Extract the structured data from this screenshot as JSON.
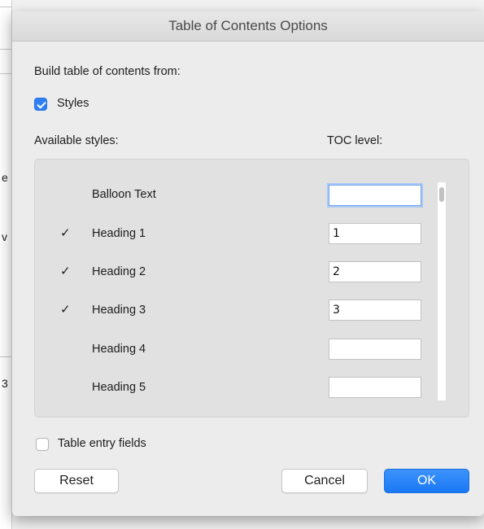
{
  "window": {
    "title": "Table of Contents Options"
  },
  "background": {
    "chars": [
      "e",
      "v",
      "3"
    ]
  },
  "build": {
    "heading": "Build table of contents from:",
    "styles_checkbox": {
      "label": "Styles",
      "checked": true
    }
  },
  "columns": {
    "available_styles": "Available styles:",
    "toc_level": "TOC level:"
  },
  "styles": [
    {
      "name": "Balloon Text",
      "checked": false,
      "level": ""
    },
    {
      "name": "Heading 1",
      "checked": true,
      "level": "1"
    },
    {
      "name": "Heading 2",
      "checked": true,
      "level": "2"
    },
    {
      "name": "Heading 3",
      "checked": true,
      "level": "3"
    },
    {
      "name": "Heading 4",
      "checked": false,
      "level": ""
    },
    {
      "name": "Heading 5",
      "checked": false,
      "level": ""
    }
  ],
  "check_glyph": "✓",
  "table_entry_fields": {
    "label": "Table entry fields",
    "checked": false
  },
  "buttons": {
    "reset": "Reset",
    "cancel": "Cancel",
    "ok": "OK"
  },
  "colors": {
    "accent": "#2f7ff5",
    "primary_button": "#1a78f5"
  }
}
